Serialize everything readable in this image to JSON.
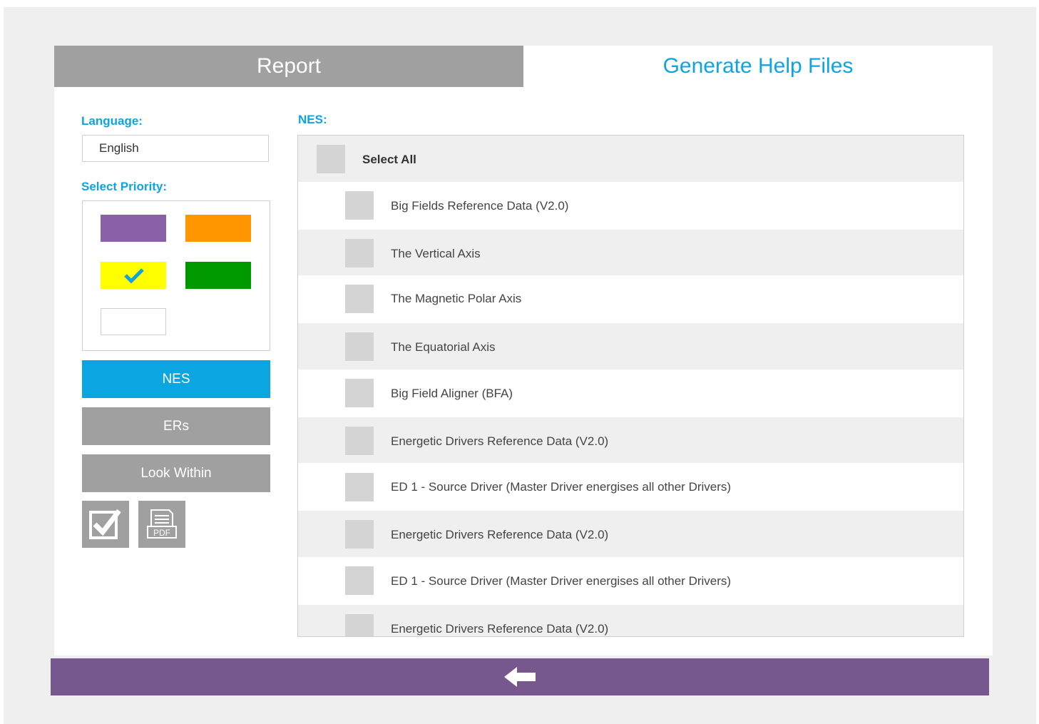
{
  "tabs": {
    "report": "Report",
    "generate_help_files": "Generate Help Files"
  },
  "language": {
    "label": "Language:",
    "value": "English"
  },
  "priority": {
    "label": "Select Priority:",
    "options": [
      {
        "name": "purple",
        "color": "#8a60a9",
        "selected": false
      },
      {
        "name": "orange",
        "color": "#ff9600",
        "selected": false
      },
      {
        "name": "yellow",
        "color": "#ffff00",
        "selected": true
      },
      {
        "name": "green",
        "color": "#009a00",
        "selected": false
      },
      {
        "name": "white",
        "color": "#ffffff",
        "selected": false
      }
    ]
  },
  "sidebar_buttons": {
    "nes": "NES",
    "ers": "ERs",
    "look_within": "Look Within"
  },
  "icons": {
    "check_button": "checkbox-icon",
    "pdf_button": "pdf-icon",
    "pdf_label": "PDF",
    "footer": "back-arrow-icon"
  },
  "nes_list": {
    "label": "NES:",
    "select_all": "Select All",
    "items": [
      "Big Fields Reference Data (V2.0)",
      "The Vertical Axis",
      "The Magnetic Polar Axis",
      "The Equatorial Axis",
      "Big Field Aligner (BFA)",
      "Energetic Drivers Reference Data (V2.0)",
      "ED 1 - Source Driver (Master Driver energises all other Drivers)",
      "Energetic Drivers Reference Data (V2.0)",
      "ED 1 - Source Driver (Master Driver energises all other Drivers)",
      "Energetic Drivers Reference Data (V2.0)"
    ]
  },
  "colors": {
    "accent": "#0fa3e0",
    "footer": "#76588e",
    "inactive_tab": "#a0a0a0"
  }
}
